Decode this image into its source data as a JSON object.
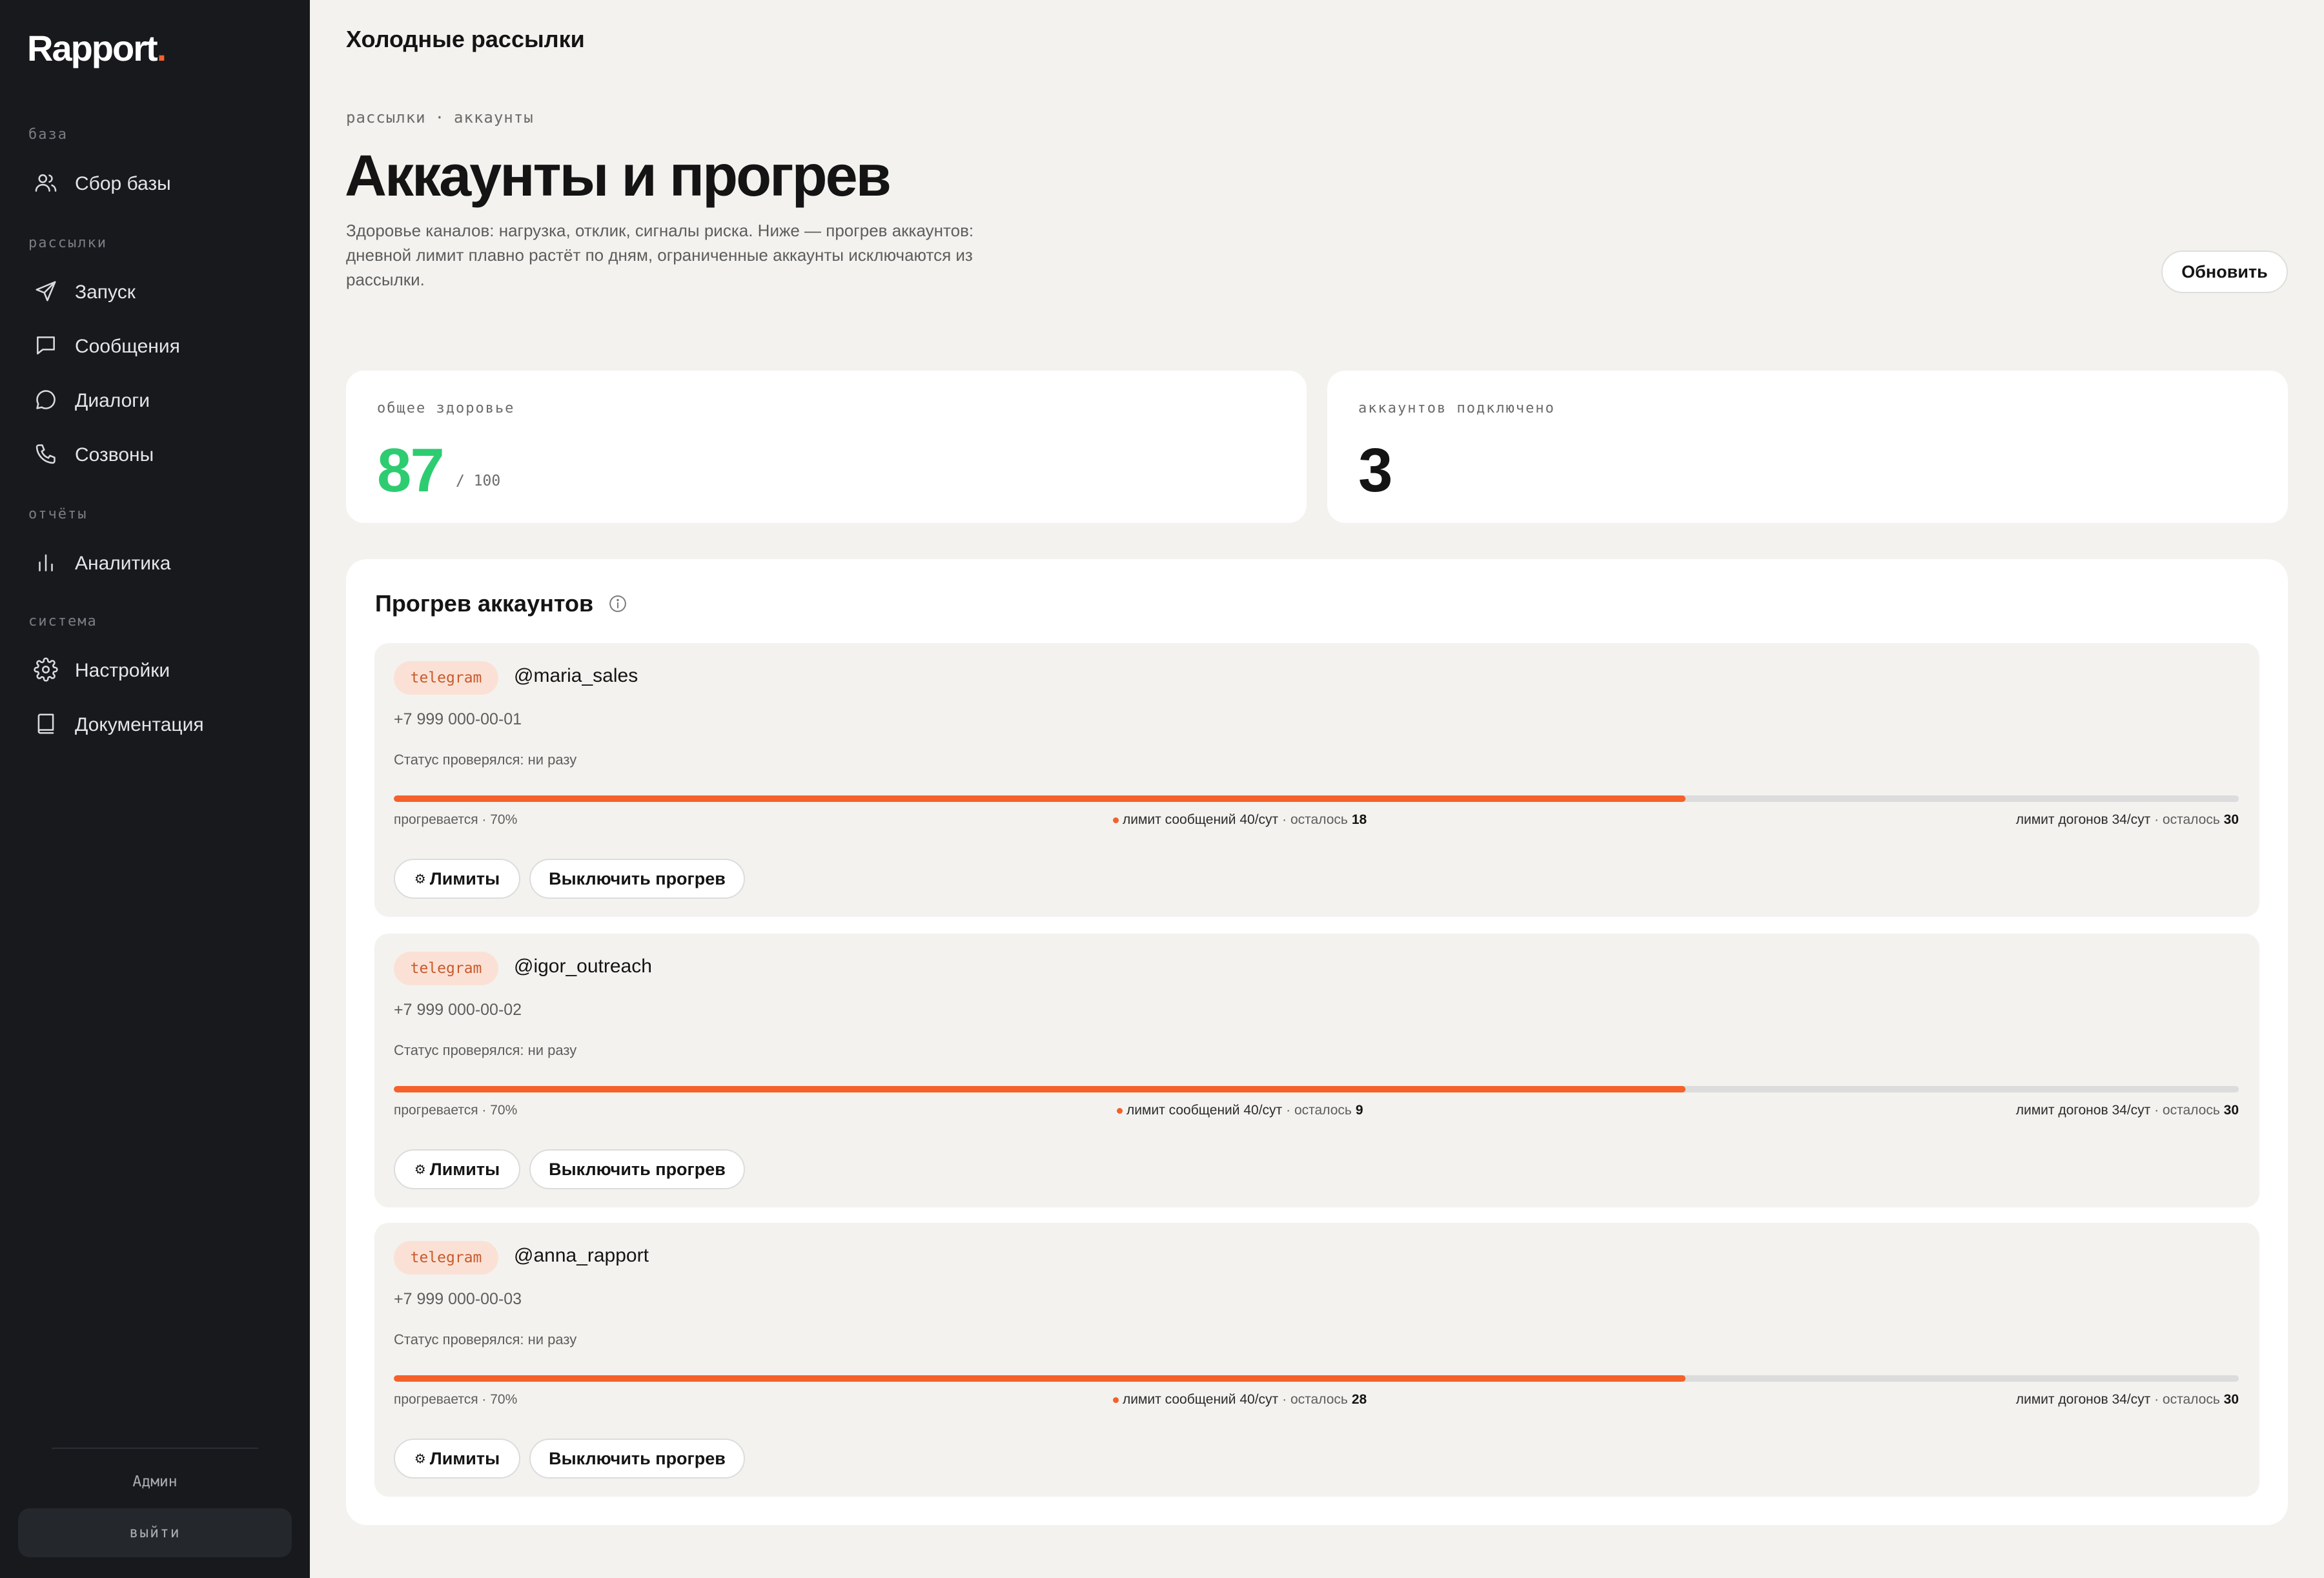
{
  "sidebar": {
    "logo": "Rapport",
    "logo_dot": ".",
    "sections": [
      {
        "label": "база",
        "items": [
          {
            "label": "Сбор базы",
            "icon": "users-icon"
          }
        ]
      },
      {
        "label": "рассылки",
        "items": [
          {
            "label": "Запуск",
            "icon": "send-icon"
          },
          {
            "label": "Сообщения",
            "icon": "message-square-icon"
          },
          {
            "label": "Диалоги",
            "icon": "chat-bubble-icon"
          },
          {
            "label": "Созвоны",
            "icon": "phone-icon"
          }
        ]
      },
      {
        "label": "отчёты",
        "items": [
          {
            "label": "Аналитика",
            "icon": "bar-chart-icon"
          }
        ]
      },
      {
        "label": "система",
        "items": [
          {
            "label": "Настройки",
            "icon": "gear-icon"
          },
          {
            "label": "Документация",
            "icon": "book-icon"
          }
        ]
      }
    ],
    "user": "Админ",
    "logout": "выйти"
  },
  "header": {
    "title": "Холодные рассылки",
    "breadcrumb": [
      "рассылки",
      "·",
      "аккаунты"
    ],
    "page_title": "Аккаунты и прогрев",
    "description": "Здоровье каналов: нагрузка, отклик, сигналы риска. Ниже — прогрев аккаунтов: дневной лимит плавно растёт по дням, ограниченные аккаунты исключаются из рассылки.",
    "refresh_label": "Обновить"
  },
  "stats": {
    "health": {
      "label": "общее здоровье",
      "value": "87",
      "max": "/ 100",
      "color": "#2ecc71"
    },
    "accounts": {
      "label": "аккаунтов подключено",
      "value": "3"
    }
  },
  "warmup": {
    "title": "Прогрев аккаунтов",
    "accounts": [
      {
        "channel": "telegram",
        "handle": "@maria_sales",
        "phone": "+7 999 000-00-01",
        "status": "Статус проверялся: ни разу",
        "progress": 0.7,
        "progress_label": "прогревается · 70%",
        "limit_msg": "лимит сообщений 40/сут",
        "limit_msg_left_label": "· осталось",
        "limit_msg_left": "18",
        "limit_fu": "лимит догонов 34/сут",
        "limit_fu_left_label": "· осталось",
        "limit_fu_left": "30",
        "btn_limits": "Лимиты",
        "btn_disable": "Выключить прогрев"
      },
      {
        "channel": "telegram",
        "handle": "@igor_outreach",
        "phone": "+7 999 000-00-02",
        "status": "Статус проверялся: ни разу",
        "progress": 0.7,
        "progress_label": "прогревается · 70%",
        "limit_msg": "лимит сообщений 40/сут",
        "limit_msg_left_label": "· осталось",
        "limit_msg_left": "9",
        "limit_fu": "лимит догонов 34/сут",
        "limit_fu_left_label": "· осталось",
        "limit_fu_left": "30",
        "btn_limits": "Лимиты",
        "btn_disable": "Выключить прогрев"
      },
      {
        "channel": "telegram",
        "handle": "@anna_rapport",
        "phone": "+7 999 000-00-03",
        "status": "Статус проверялся: ни разу",
        "progress": 0.7,
        "progress_label": "прогревается · 70%",
        "limit_msg": "лимит сообщений 40/сут",
        "limit_msg_left_label": "· осталось",
        "limit_msg_left": "28",
        "limit_fu": "лимит догонов 34/сут",
        "limit_fu_left_label": "· осталось",
        "limit_fu_left": "30",
        "btn_limits": "Лимиты",
        "btn_disable": "Выключить прогрев"
      }
    ]
  },
  "colors": {
    "accent": "#f4612a",
    "sidebar_bg": "#17191d",
    "page_bg": "#f3f2ef",
    "health_green": "#2ecc71"
  }
}
